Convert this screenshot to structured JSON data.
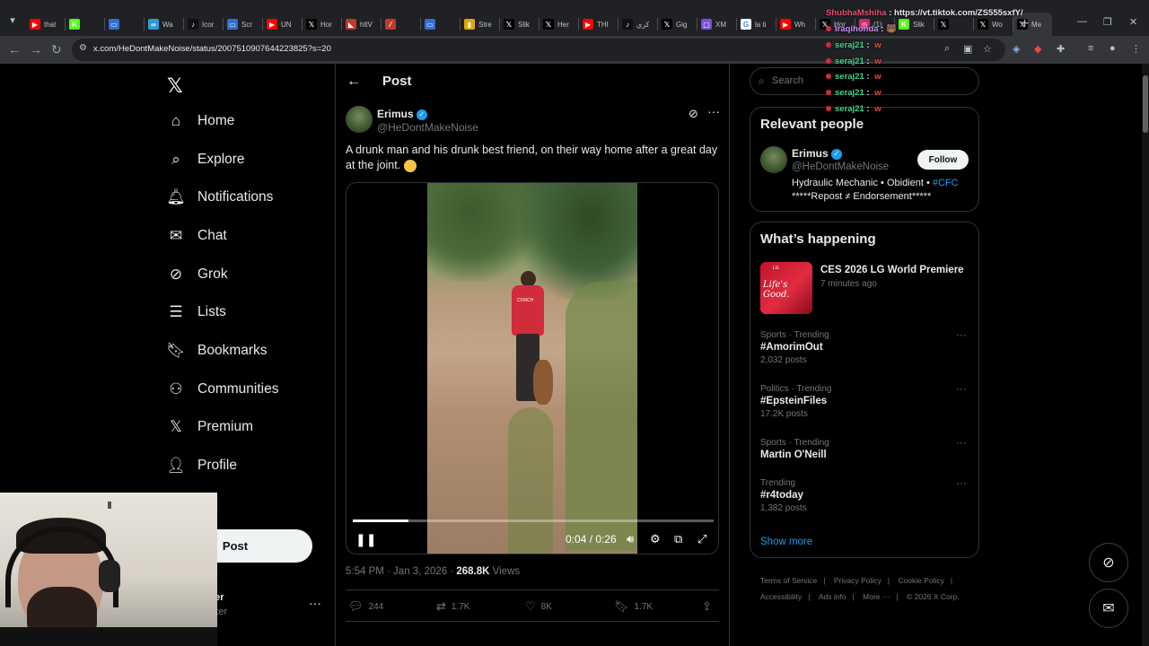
{
  "browser": {
    "tabs": [
      {
        "title": "that",
        "favicon": "youtube-icon",
        "color": "#ff0000",
        "glyph": "▶"
      },
      {
        "title": "",
        "favicon": "kick-icon",
        "color": "#53fc18",
        "glyph": "K"
      },
      {
        "title": "",
        "favicon": "window-icon",
        "color": "#2f6fd6",
        "glyph": "▭"
      },
      {
        "title": "Wa",
        "favicon": "link-icon",
        "color": "#2f9bd6",
        "glyph": "∞"
      },
      {
        "title": "Icor",
        "favicon": "tiktok-icon",
        "color": "#111111",
        "glyph": "♪"
      },
      {
        "title": "Scr",
        "favicon": "window-icon",
        "color": "#2f6fd6",
        "glyph": "▭"
      },
      {
        "title": "UN",
        "favicon": "youtube-icon",
        "color": "#ff0000",
        "glyph": "▶"
      },
      {
        "title": "Hor",
        "favicon": "x-icon",
        "color": "#000000",
        "glyph": "𝕏"
      },
      {
        "title": "hltV",
        "favicon": "hltv-icon",
        "color": "#c0392b",
        "glyph": "◣"
      },
      {
        "title": "",
        "favicon": "slash-icon",
        "color": "#c0392b",
        "glyph": "⁄"
      },
      {
        "title": "",
        "favicon": "window-icon",
        "color": "#2f6fd6",
        "glyph": "▭"
      },
      {
        "title": "Stre",
        "favicon": "chart-icon",
        "color": "#e0a800",
        "glyph": "▮"
      },
      {
        "title": "Slik",
        "favicon": "x-icon",
        "color": "#000000",
        "glyph": "𝕏"
      },
      {
        "title": "Her",
        "favicon": "x-icon",
        "color": "#000000",
        "glyph": "𝕏"
      },
      {
        "title": "THI",
        "favicon": "youtube-icon",
        "color": "#ff0000",
        "glyph": "▶"
      },
      {
        "title": "کري",
        "favicon": "tiktok-icon",
        "color": "#111111",
        "glyph": "♪"
      },
      {
        "title": "Gig",
        "favicon": "x-icon",
        "color": "#000000",
        "glyph": "𝕏"
      },
      {
        "title": "XM",
        "favicon": "xm-icon",
        "color": "#7b4fd6",
        "glyph": "▢"
      },
      {
        "title": "la ti",
        "favicon": "google-icon",
        "color": "#ffffff",
        "glyph": "G"
      },
      {
        "title": "Wh",
        "favicon": "youtube-icon",
        "color": "#ff0000",
        "glyph": "▶"
      },
      {
        "title": "Hor",
        "favicon": "x-icon",
        "color": "#000000",
        "glyph": "𝕏"
      },
      {
        "title": "(1)",
        "favicon": "instagram-icon",
        "color": "#d6246e",
        "glyph": "◎"
      },
      {
        "title": "Slik",
        "favicon": "kick-icon",
        "color": "#53fc18",
        "glyph": "K"
      },
      {
        "title": "",
        "favicon": "x-icon",
        "color": "#000000",
        "glyph": "𝕏"
      },
      {
        "title": "Wo",
        "favicon": "x-icon",
        "color": "#000000",
        "glyph": "𝕏"
      },
      {
        "title": "Me",
        "favicon": "x-icon",
        "color": "#000000",
        "glyph": "𝕏",
        "active": true
      }
    ],
    "url": "x.com/HeDontMakeNoise/status/2007510907644223825?s=20"
  },
  "nav": {
    "items": [
      {
        "name": "home",
        "label": "Home",
        "icon": "⌂"
      },
      {
        "name": "explore",
        "label": "Explore",
        "icon": "⌕"
      },
      {
        "name": "notifications",
        "label": "Notifications",
        "icon": "🔔︎"
      },
      {
        "name": "chat",
        "label": "Chat",
        "icon": "✉"
      },
      {
        "name": "grok",
        "label": "Grok",
        "icon": "⊘"
      },
      {
        "name": "lists",
        "label": "Lists",
        "icon": "☰"
      },
      {
        "name": "bookmarks",
        "label": "Bookmarks",
        "icon": "🔖︎"
      },
      {
        "name": "communities",
        "label": "Communities",
        "icon": "⚇"
      },
      {
        "name": "premium",
        "label": "Premium",
        "icon": "𝕏"
      },
      {
        "name": "profile",
        "label": "Profile",
        "icon": "👤︎"
      },
      {
        "name": "more",
        "label": "re",
        "icon": ""
      }
    ],
    "post_button": "Post",
    "account": {
      "name": "ker",
      "handle": "liker"
    }
  },
  "post": {
    "header": "Post",
    "author": {
      "name": "Erimus",
      "handle": "@HeDontMakeNoise"
    },
    "text": "A drunk man and his drunk best friend, on their way home after a great day at the joint.",
    "video": {
      "time": "0:04 / 0:26",
      "progress": 0.154,
      "shirt_text": "CONCH"
    },
    "timestamp": "5:54 PM · Jan 3, 2026 · ",
    "views_count": "268.8K",
    "views_label": " Views",
    "actions": {
      "replies": "244",
      "reposts": "1.7K",
      "likes": "8K",
      "bookmarks": "1.7K"
    }
  },
  "sidebar": {
    "search_placeholder": "Search",
    "relevant": {
      "title": "Relevant people",
      "name": "Erimus",
      "handle": "@HeDontMakeNoise",
      "follow": "Follow",
      "bio_line1": "Hydraulic Mechanic • Obidient • ",
      "bio_hashtag": "#CFC",
      "bio_line2": "*****Repost ≠ Endorsement*****"
    },
    "happening": {
      "title": "What’s happening",
      "feature": {
        "title": "CES 2026 LG World Premiere",
        "time": "7 minutes ago",
        "image_text": "Life's Good.",
        "image_brand": "LG"
      },
      "trends": [
        {
          "context": "Sports · Trending",
          "name": "#AmorimOut",
          "posts": "2,032 posts"
        },
        {
          "context": "Politics · Trending",
          "name": "#EpsteinFiles",
          "posts": "17.2K posts"
        },
        {
          "context": "Sports · Trending",
          "name": "Martin O'Neill",
          "posts": ""
        },
        {
          "context": "Trending",
          "name": "#r4today",
          "posts": "1,382 posts"
        }
      ],
      "show_more": "Show more"
    },
    "footer": {
      "line1": [
        "Terms of Service",
        "Privacy Policy",
        "Cookie Policy"
      ],
      "line2": [
        "Accessibility",
        "Ads info",
        "More ···",
        "© 2026 X Corp."
      ]
    }
  },
  "overlay_chat": {
    "top": {
      "user": "ShubhaMshiha",
      "msg": "https://vt.tiktok.com/ZS555sxfY/"
    },
    "second": {
      "user": "Iraqihonda",
      "msg": "🐻"
    },
    "lines": [
      {
        "user": "seraj21",
        "msg": "w"
      },
      {
        "user": "seraj21",
        "msg": "w"
      },
      {
        "user": "seraj21",
        "msg": "w"
      },
      {
        "user": "seraj21",
        "msg": "w"
      },
      {
        "user": "seraj21",
        "msg": "w"
      }
    ]
  }
}
